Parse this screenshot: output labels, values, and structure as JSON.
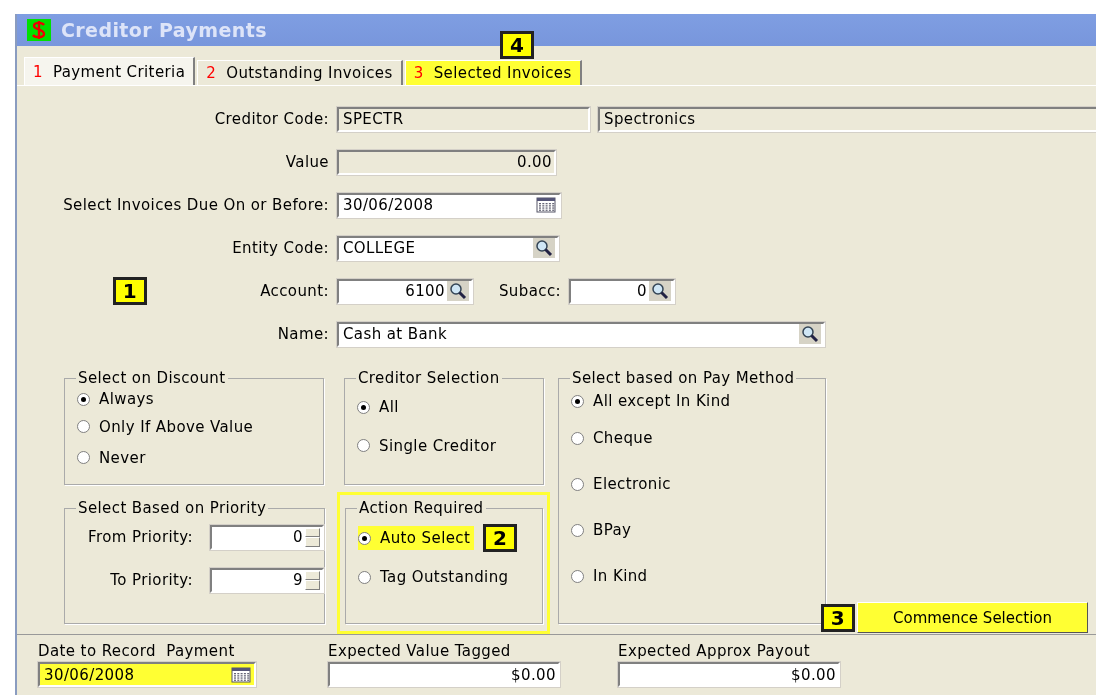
{
  "window": {
    "title": "Creditor Payments"
  },
  "tabs": [
    {
      "number": "1",
      "label": "Payment Criteria",
      "selected": true,
      "highlighted": false
    },
    {
      "number": "2",
      "label": "Outstanding Invoices",
      "selected": false,
      "highlighted": false
    },
    {
      "number": "3",
      "label": "Selected Invoices",
      "selected": false,
      "highlighted": true,
      "callout": "4"
    }
  ],
  "creditor_code": {
    "label": "Creditor Code:",
    "value": "SPECTR",
    "name_value": "Spectronics"
  },
  "value": {
    "label": "Value",
    "value": "0.00"
  },
  "due_date": {
    "label": "Select Invoices Due On or Before:",
    "value": "30/06/2008"
  },
  "entity_code": {
    "label": "Entity Code:",
    "value": "COLLEGE"
  },
  "account": {
    "label": "Account:",
    "value": "6100",
    "callout": "1"
  },
  "subaccount": {
    "label": "Subacc:",
    "value": "0"
  },
  "name": {
    "label": "Name:",
    "value": "Cash at Bank"
  },
  "select_on_discount": {
    "title": "Select on Discount",
    "options": [
      {
        "label": "Always",
        "selected": true
      },
      {
        "label": "Only If Above Value",
        "selected": false
      },
      {
        "label": "Never",
        "selected": false
      }
    ]
  },
  "creditor_selection": {
    "title": "Creditor Selection",
    "options": [
      {
        "label": "All",
        "selected": true
      },
      {
        "label": "Single Creditor",
        "selected": false
      }
    ]
  },
  "pay_method": {
    "title": "Select based on Pay Method",
    "options": [
      {
        "label": "All except In Kind",
        "selected": true
      },
      {
        "label": "Cheque",
        "selected": false
      },
      {
        "label": "Electronic",
        "selected": false
      },
      {
        "label": "BPay",
        "selected": false
      },
      {
        "label": "In Kind",
        "selected": false
      }
    ]
  },
  "priority": {
    "title": "Select Based on Priority",
    "from": {
      "label": "From Priority:",
      "value": "0"
    },
    "to": {
      "label": "To Priority:",
      "value": "9"
    }
  },
  "action_required": {
    "title": "Action Required",
    "highlighted": true,
    "options": [
      {
        "label": "Auto Select",
        "selected": true,
        "highlighted": true,
        "callout": "2"
      },
      {
        "label": "Tag Outstanding",
        "selected": false,
        "highlighted": false
      }
    ]
  },
  "commence_button": {
    "label": "Commence Selection",
    "highlighted": true,
    "callout": "3"
  },
  "record_date": {
    "label": "Date to Record  Payment",
    "value": "30/06/2008",
    "highlighted": true
  },
  "expected_value": {
    "label": "Expected Value Tagged",
    "value": "$0.00"
  },
  "expected_payout": {
    "label": "Expected Approx Payout",
    "value": "$0.00"
  }
}
